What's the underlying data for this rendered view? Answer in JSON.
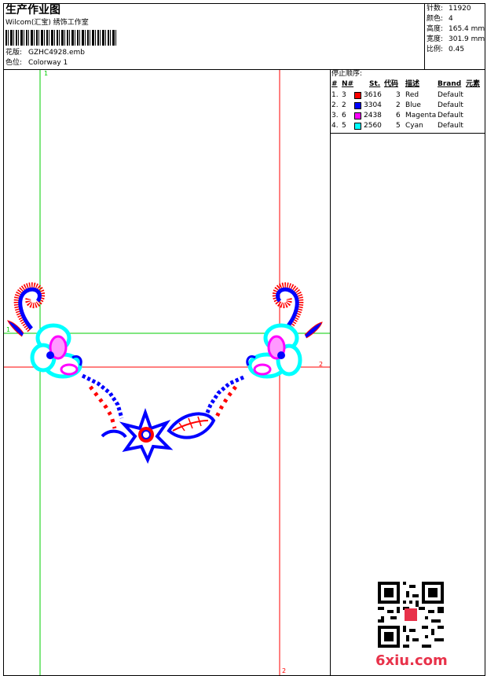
{
  "header": {
    "title": "生产作业图",
    "subtitle": "Wilcom(汇宝) 绣饰工作室",
    "design_label": "花版:",
    "design_value": "GZHC4928.emb",
    "colorway_label": "色位:",
    "colorway_value": "Colorway 1"
  },
  "stats": [
    {
      "label": "针数:",
      "value": "11920"
    },
    {
      "label": "颜色:",
      "value": "4"
    },
    {
      "label": "高度:",
      "value": "165.4 mm"
    },
    {
      "label": "宽度:",
      "value": "301.9 mm"
    },
    {
      "label": "比例:",
      "value": "0.45"
    }
  ],
  "stop_sequence": {
    "title": "停止顺序:",
    "headers": [
      "#",
      "N#",
      "St.",
      "代码",
      "描述",
      "Brand",
      "元素"
    ],
    "rows": [
      {
        "idx": "1.",
        "n": "3",
        "color": "#ff0000",
        "st": "3616",
        "code": "3",
        "desc": "Red",
        "brand": "Default"
      },
      {
        "idx": "2.",
        "n": "2",
        "color": "#0000ff",
        "st": "3304",
        "code": "2",
        "desc": "Blue",
        "brand": "Default"
      },
      {
        "idx": "3.",
        "n": "6",
        "color": "#ff00ff",
        "st": "2438",
        "code": "6",
        "desc": "Magenta",
        "brand": "Default"
      },
      {
        "idx": "4.",
        "n": "5",
        "color": "#00ffff",
        "st": "2560",
        "code": "5",
        "desc": "Cyan",
        "brand": "Default"
      }
    ]
  },
  "markers": {
    "green_v": "1",
    "green_h": "1",
    "red_h": "2",
    "red_v": "2"
  },
  "watermark": "6xiu.com",
  "colors": {
    "red": "#ff0000",
    "blue": "#0000ff",
    "magenta": "#ff00ff",
    "cyan": "#00ffff",
    "green": "#00cc00"
  }
}
